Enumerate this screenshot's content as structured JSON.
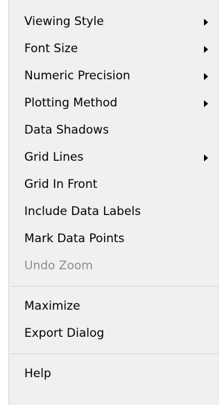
{
  "menu": {
    "group1": [
      {
        "label": "Viewing Style",
        "submenu": true,
        "disabled": false
      },
      {
        "label": "Font Size",
        "submenu": true,
        "disabled": false
      },
      {
        "label": "Numeric Precision",
        "submenu": true,
        "disabled": false
      },
      {
        "label": "Plotting Method",
        "submenu": true,
        "disabled": false
      },
      {
        "label": "Data Shadows",
        "submenu": false,
        "disabled": false
      },
      {
        "label": "Grid Lines",
        "submenu": true,
        "disabled": false
      },
      {
        "label": "Grid In Front",
        "submenu": false,
        "disabled": false
      },
      {
        "label": "Include Data Labels",
        "submenu": false,
        "disabled": false
      },
      {
        "label": "Mark Data Points",
        "submenu": false,
        "disabled": false
      },
      {
        "label": "Undo Zoom",
        "submenu": false,
        "disabled": true
      }
    ],
    "group2": [
      {
        "label": "Maximize",
        "submenu": false,
        "disabled": false
      },
      {
        "label": "Export Dialog",
        "submenu": false,
        "disabled": false
      }
    ],
    "group3": [
      {
        "label": "Help",
        "submenu": false,
        "disabled": false
      }
    ]
  },
  "colors": {
    "menu_background": "#f0f0f0",
    "disabled_text": "#8d8d8d",
    "separator": "#d7d7d7"
  },
  "icons": {
    "submenu_arrow": "chevron-right-icon"
  }
}
